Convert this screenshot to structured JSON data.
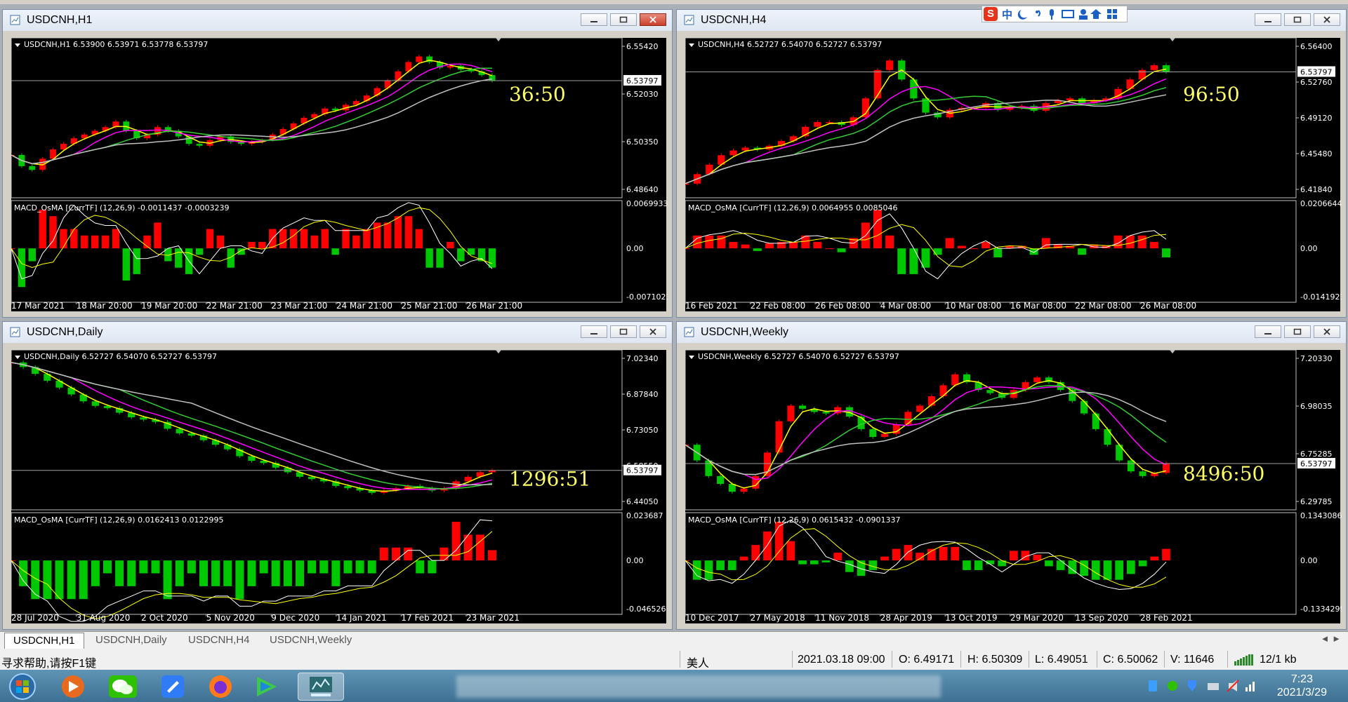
{
  "windows": [
    {
      "title": "USDCNH,H1",
      "info": "USDCNH,H1  6.53900 6.53971 6.53778 6.53797",
      "price_labels": [
        "6.55420",
        "6.52030",
        "6.50350",
        "6.48640"
      ],
      "current_price": "6.53797",
      "timer": "36:50",
      "macd_label": "MACD_OsMA [CurrTF] (12,26,9) -0.0011437 -0.0003239",
      "macd_labels": [
        "0.0069933",
        "0.00",
        "-0.0071023"
      ],
      "date_labels": [
        "17 Mar 2021",
        "18 Mar 20:00",
        "19 Mar 20:00",
        "22 Mar 21:00",
        "23 Mar 21:00",
        "24 Mar 21:00",
        "25 Mar 21:00",
        "26 Mar 21:00"
      ]
    },
    {
      "title": "USDCNH,H4",
      "info": "USDCNH,H4  6.52727 6.54070 6.52727 6.53797",
      "price_labels": [
        "6.56400",
        "6.52760",
        "6.49120",
        "6.45480",
        "6.41840"
      ],
      "current_price": "6.53797",
      "timer": "96:50",
      "macd_label": "MACD_OsMA [CurrTF] (12,26,9) 0.0064955 0.0085046",
      "macd_labels": [
        "0.0206644",
        "0.00",
        "-0.0141923"
      ],
      "date_labels": [
        "16 Feb 2021",
        "22 Feb 08:00",
        "26 Feb 08:00",
        "4 Mar 08:00",
        "10 Mar 08:00",
        "16 Mar 08:00",
        "22 Mar 08:00",
        "26 Mar 08:00"
      ]
    },
    {
      "title": "USDCNH,Daily",
      "info": "USDCNH,Daily  6.52727 6.54070 6.52727 6.53797",
      "price_labels": [
        "7.02340",
        "6.87840",
        "6.73050",
        "6.58550",
        "6.44050"
      ],
      "current_price": "6.53797",
      "timer": "1296:51",
      "macd_label": "MACD_OsMA [CurrTF] (12,26,9) 0.0162413 0.0122995",
      "macd_labels": [
        "0.023687",
        "0.00",
        "-0.046526"
      ],
      "date_labels": [
        "28 Jul 2020",
        "31 Aug 2020",
        "2 Oct 2020",
        "5 Nov 2020",
        "9 Dec 2020",
        "14 Jan 2021",
        "17 Feb 2021",
        "23 Mar 2021"
      ]
    },
    {
      "title": "USDCNH,Weekly",
      "info": "USDCNH,Weekly  6.52727 6.54070 6.52727 6.53797",
      "price_labels": [
        "7.20330",
        "6.98035",
        "6.75285",
        "6.29785"
      ],
      "current_price": "6.53797",
      "timer": "8496:50",
      "macd_label": "MACD_OsMA [CurrTF] (12,26,9) 0.0615432 -0.0901337",
      "macd_labels": [
        "0.1343086",
        "0.00",
        "-0.1334299"
      ],
      "date_labels": [
        "10 Dec 2017",
        "27 May 2018",
        "11 Nov 2018",
        "28 Apr 2019",
        "13 Oct 2019",
        "29 Mar 2020",
        "13 Sep 2020",
        "28 Feb 2021"
      ]
    }
  ],
  "tabs": [
    "USDCNH,H1",
    "USDCNH,Daily",
    "USDCNH,H4",
    "USDCNH,Weekly"
  ],
  "status": {
    "help": "寻求帮助,请按F1键",
    "profile": "美人",
    "datetime": "2021.03.18 09:00",
    "open": "O: 6.49171",
    "high": "H: 6.50309",
    "low": "L: 6.49051",
    "close": "C: 6.50062",
    "volume": "V: 11646",
    "traffic": "12/1 kb"
  },
  "ime": "中",
  "clock": {
    "time": "7:23",
    "date": "2021/3/29"
  },
  "colors": {
    "bull": "#ff0000",
    "bear": "#00c800",
    "timer": "#ffff66",
    "ma_yellow": "#ffff00",
    "ma_magenta": "#ff00ff",
    "ma_green": "#33cc33",
    "ma_silver": "#c0c0c0"
  },
  "chart_data": [
    {
      "type": "line",
      "title": "USDCNH,H1",
      "ylim": [
        6.478,
        6.558
      ],
      "close": [
        6.498,
        6.492,
        6.49,
        6.496,
        6.501,
        6.504,
        6.507,
        6.509,
        6.511,
        6.513,
        6.516,
        6.511,
        6.507,
        6.509,
        6.513,
        6.511,
        6.508,
        6.504,
        6.503,
        6.506,
        6.508,
        6.505,
        6.504,
        6.505,
        6.506,
        6.509,
        6.512,
        6.515,
        6.518,
        6.52,
        6.523,
        6.522,
        6.525,
        6.527,
        6.53,
        6.534,
        6.538,
        6.543,
        6.548,
        6.551,
        6.548,
        6.545,
        6.546,
        6.544,
        6.543,
        6.541,
        6.538
      ]
    },
    {
      "type": "line",
      "title": "USDCNH,H4",
      "ylim": [
        6.411,
        6.568
      ],
      "close": [
        6.42,
        6.43,
        6.44,
        6.45,
        6.455,
        6.458,
        6.456,
        6.46,
        6.465,
        6.47,
        6.48,
        6.485,
        6.485,
        6.482,
        6.49,
        6.51,
        6.54,
        6.55,
        6.53,
        6.51,
        6.495,
        6.49,
        6.498,
        6.5,
        6.5,
        6.505,
        6.498,
        6.5,
        6.502,
        6.497,
        6.505,
        6.508,
        6.51,
        6.505,
        6.508,
        6.51,
        6.52,
        6.53,
        6.54,
        6.545,
        6.538
      ]
    },
    {
      "type": "line",
      "title": "USDCNH,Daily",
      "ylim": [
        6.39,
        7.04
      ],
      "close": [
        7.01,
        6.99,
        6.96,
        6.93,
        6.9,
        6.87,
        6.84,
        6.82,
        6.81,
        6.79,
        6.77,
        6.76,
        6.75,
        6.72,
        6.7,
        6.69,
        6.67,
        6.65,
        6.63,
        6.6,
        6.58,
        6.57,
        6.55,
        6.53,
        6.51,
        6.5,
        6.49,
        6.47,
        6.46,
        6.45,
        6.44,
        6.45,
        6.46,
        6.47,
        6.46,
        6.45,
        6.46,
        6.49,
        6.51,
        6.53,
        6.538
      ]
    },
    {
      "type": "line",
      "title": "USDCNH,Weekly",
      "ylim": [
        6.27,
        7.22
      ],
      "close": [
        6.65,
        6.55,
        6.45,
        6.4,
        6.35,
        6.37,
        6.45,
        6.6,
        6.8,
        6.9,
        6.88,
        6.86,
        6.85,
        6.89,
        6.83,
        6.75,
        6.7,
        6.72,
        6.78,
        6.86,
        6.9,
        6.96,
        7.03,
        7.1,
        7.05,
        7.0,
        6.98,
        6.95,
        7.0,
        7.05,
        7.08,
        7.05,
        7.0,
        6.93,
        6.85,
        6.75,
        6.65,
        6.55,
        6.48,
        6.45,
        6.47,
        6.53
      ]
    }
  ]
}
